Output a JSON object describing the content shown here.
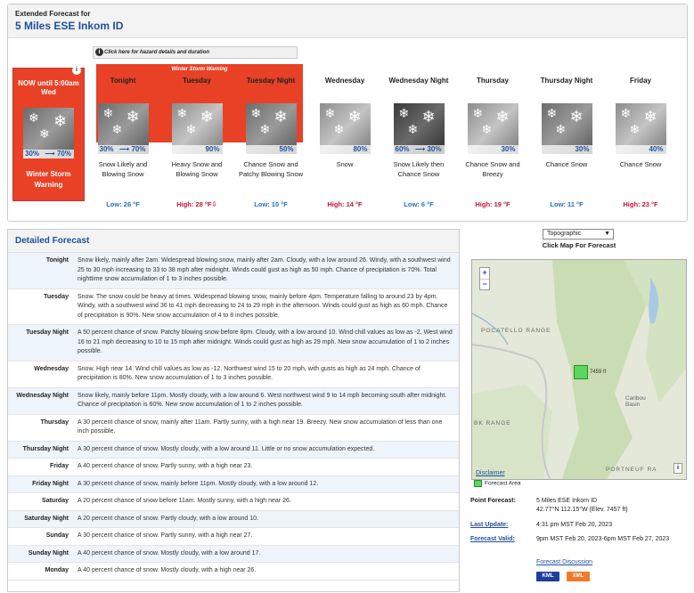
{
  "header": {
    "subtitle": "Extended Forecast for",
    "location": "5 Miles ESE Inkom ID"
  },
  "hazard": {
    "button_label": "Click here for hazard details and duration",
    "band_title": "Winter Storm Warning"
  },
  "now": {
    "name": "NOW until 5:00am Wed",
    "pct_from": "30%",
    "pct_to": "70%",
    "warning": "Winter Storm Warning"
  },
  "periods": [
    {
      "name": "Tonight",
      "pct_from": "30%",
      "pct_to": "70%",
      "desc": "Snow Likely and Blowing Snow",
      "temp": "Low: 26 °F",
      "kind": "lo"
    },
    {
      "name": "Tuesday",
      "pct_from": "",
      "pct_to": "90%",
      "desc": "Heavy Snow and Blowing Snow",
      "temp": "High: 28 °F⇩",
      "kind": "hi"
    },
    {
      "name": "Tuesday Night",
      "pct_from": "",
      "pct_to": "50%",
      "desc": "Chance Snow and Patchy Blowing Snow",
      "temp": "Low: 10 °F",
      "kind": "lo"
    },
    {
      "name": "Wednesday",
      "pct_from": "",
      "pct_to": "80%",
      "desc": "Snow",
      "temp": "High: 14 °F",
      "kind": "hi"
    },
    {
      "name": "Wednesday Night",
      "pct_from": "60%",
      "pct_to": "30%",
      "desc": "Snow Likely then Chance Snow",
      "temp": "Low: 6 °F",
      "kind": "lo"
    },
    {
      "name": "Thursday",
      "pct_from": "",
      "pct_to": "30%",
      "desc": "Chance Snow and Breezy",
      "temp": "High: 19 °F",
      "kind": "hi"
    },
    {
      "name": "Thursday Night",
      "pct_from": "",
      "pct_to": "30%",
      "desc": "Chance Snow",
      "temp": "Low: 11 °F",
      "kind": "lo"
    },
    {
      "name": "Friday",
      "pct_from": "",
      "pct_to": "40%",
      "desc": "Chance Snow",
      "temp": "High: 23 °F",
      "kind": "hi"
    }
  ],
  "detailed": {
    "title": "Detailed Forecast",
    "rows": [
      {
        "label": "Tonight",
        "text": "Snow likely, mainly after 2am. Widespread blowing snow, mainly after 2am. Cloudy, with a low around 26. Windy, with a southwest wind 25 to 30 mph increasing to 33 to 38 mph after midnight. Winds could gust as high as 50 mph. Chance of precipitation is 70%. Total nighttime snow accumulation of 1 to 3 inches possible."
      },
      {
        "label": "Tuesday",
        "text": "Snow. The snow could be heavy at times. Widespread blowing snow, mainly before 4pm. Temperature falling to around 23 by 4pm. Windy, with a southwest wind 36 to 41 mph decreasing to 24 to 29 mph in the afternoon. Winds could gust as high as 60 mph. Chance of precipitation is 90%. New snow accumulation of 4 to 8 inches possible."
      },
      {
        "label": "Tuesday Night",
        "text": "A 50 percent chance of snow. Patchy blowing snow before 8pm. Cloudy, with a low around 10. Wind chill values as low as -2. West wind 16 to 21 mph decreasing to 10 to 15 mph after midnight. Winds could gust as high as 29 mph. New snow accumulation of 1 to 2 inches possible."
      },
      {
        "label": "Wednesday",
        "text": "Snow. High near 14. Wind chill values as low as -12. Northwest wind 15 to 20 mph, with gusts as high as 24 mph. Chance of precipitation is 80%. New snow accumulation of 1 to 3 inches possible."
      },
      {
        "label": "Wednesday Night",
        "text": "Snow likely, mainly before 11pm. Mostly cloudy, with a low around 6. West northwest wind 9 to 14 mph becoming south after midnight. Chance of precipitation is 60%. New snow accumulation of 1 to 2 inches possible."
      },
      {
        "label": "Thursday",
        "text": "A 30 percent chance of snow, mainly after 11am. Partly sunny, with a high near 19. Breezy. New snow accumulation of less than one inch possible."
      },
      {
        "label": "Thursday Night",
        "text": "A 30 percent chance of snow. Mostly cloudy, with a low around 11. Little or no snow accumulation expected."
      },
      {
        "label": "Friday",
        "text": "A 40 percent chance of snow. Partly sunny, with a high near 23."
      },
      {
        "label": "Friday Night",
        "text": "A 30 percent chance of snow, mainly before 11pm. Mostly cloudy, with a low around 12."
      },
      {
        "label": "Saturday",
        "text": "A 20 percent chance of snow before 11am. Mostly sunny, with a high near 26."
      },
      {
        "label": "Saturday Night",
        "text": "A 20 percent chance of snow. Partly cloudy, with a low around 10."
      },
      {
        "label": "Sunday",
        "text": "A 30 percent chance of snow. Partly sunny, with a high near 27."
      },
      {
        "label": "Sunday Night",
        "text": "A 40 percent chance of snow. Mostly cloudy, with a low around 17."
      },
      {
        "label": "Monday",
        "text": "A 40 percent chance of snow. Mostly cloudy, with a high near 26."
      }
    ]
  },
  "map": {
    "layer_select": "Topographic",
    "hint": "Click Map For Forecast",
    "zoom_in": "+",
    "zoom_out": "−",
    "elev_label": "7459 ft",
    "label_pocatello": "POCATELLO RANGE",
    "label_caribou": "Caribou Basin",
    "label_portneuf": "PORTNEUF RA",
    "label_bk": "BK RANGE",
    "disclaimer": "Disclaimer",
    "legend": "Forecast Area"
  },
  "info": {
    "point_label": "Point Forecast:",
    "point_name": "5 Miles ESE Inkom ID",
    "point_coords": "42.77°N 112.15°W (Elev. 7457 ft)",
    "update_label": "Last Update:",
    "update_value": "4:31 pm MST Feb 20, 2023",
    "valid_label": "Forecast Valid:",
    "valid_value": "9pm MST Feb 20, 2023-6pm MST Feb 27, 2023",
    "discussion": "Forecast Discussion",
    "kml": "KML",
    "xml": "XML"
  },
  "colors": {
    "warning_red": "#e84126",
    "link_blue": "#1f4f9c",
    "low_blue": "#1f6fc6",
    "high_red": "#c8102e"
  }
}
